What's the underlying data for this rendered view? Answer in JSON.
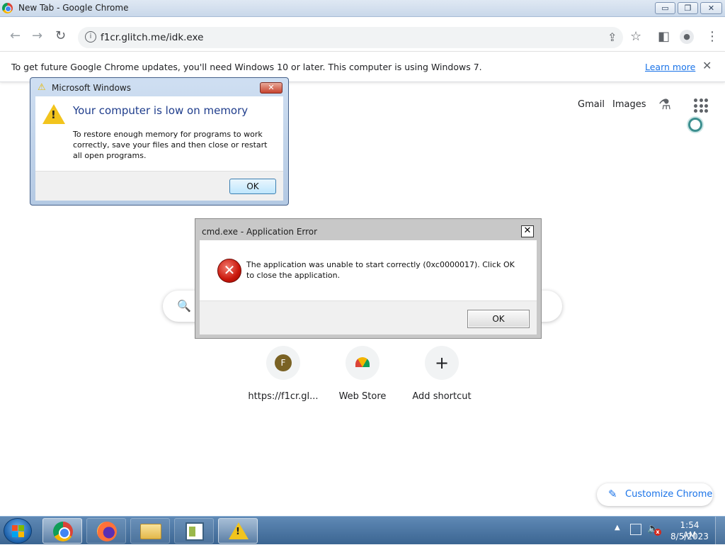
{
  "window": {
    "title": "New Tab - Google Chrome",
    "min_glyph": "▭",
    "max_glyph": "❐",
    "close_glyph": "✕"
  },
  "toolbar": {
    "back_glyph": "←",
    "forward_glyph": "→",
    "reload_glyph": "↻",
    "info_glyph": "i",
    "url": "f1cr.glitch.me/idk.exe",
    "share_glyph": "⇪",
    "star_glyph": "☆",
    "sidepanel_glyph": "◧",
    "profile_glyph": "●",
    "menu_glyph": "⋮"
  },
  "infobar": {
    "message": "To get future Google Chrome updates, you'll need Windows 10 or later. This computer is using Windows 7.",
    "learn_more": "Learn more",
    "close_glyph": "✕"
  },
  "ntp": {
    "gmail": "Gmail",
    "images": "Images",
    "labs_glyph": "⚗",
    "search_glyph": "🔍",
    "shortcuts": [
      {
        "label": "https://f1cr.gl...",
        "letter": "F"
      },
      {
        "label": "Web Store"
      },
      {
        "label": "Add shortcut",
        "glyph": "+"
      }
    ],
    "customize": "Customize Chrome",
    "customize_glyph": "✎"
  },
  "dialog_memory": {
    "title": "Microsoft Windows",
    "warn_glyph": "⚠",
    "mark": "!",
    "close_glyph": "✕",
    "heading": "Your computer is low on memory",
    "body": "To restore enough memory for programs to work correctly, save your files and then close or restart all open programs.",
    "ok": "OK"
  },
  "dialog_error": {
    "title": "cmd.exe - Application Error",
    "close_glyph": "✕",
    "error_glyph": "✕",
    "body": "The application was unable to start correctly (0xc0000017). Click OK to close the application.",
    "ok": "OK"
  },
  "taskbar": {
    "tray_up_glyph": "▲",
    "volume_glyph": "🔈",
    "volume_x": "x",
    "warn_mark": "!",
    "time": "1:54 AM",
    "date": "8/5/2023"
  },
  "colors": {
    "accent": "#1a73e8",
    "taskbar": "#3b6592",
    "error_red": "#c9160b",
    "warning_yellow": "#f2c41d"
  }
}
